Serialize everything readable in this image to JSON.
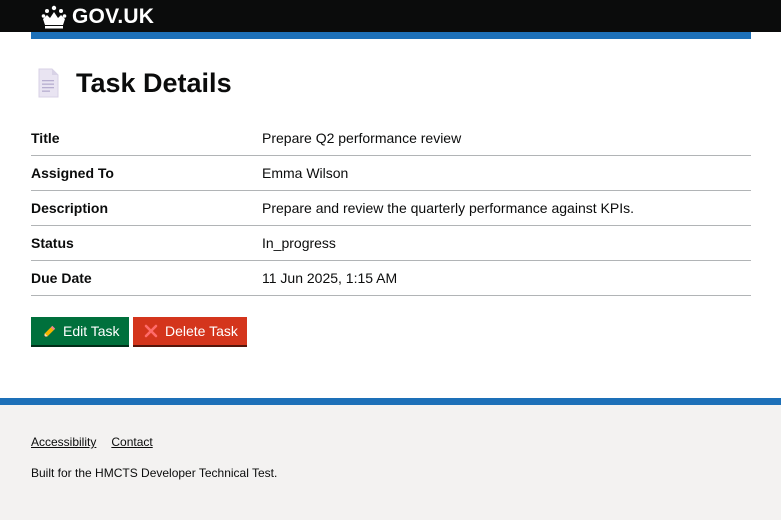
{
  "header": {
    "logo_text": "GOV.UK"
  },
  "page": {
    "title": "Task Details",
    "title_icon": "document-icon"
  },
  "summary": [
    {
      "key": "Title",
      "value": "Prepare Q2 performance review"
    },
    {
      "key": "Assigned To",
      "value": "Emma Wilson"
    },
    {
      "key": "Description",
      "value": "Prepare and review the quarterly performance against KPIs."
    },
    {
      "key": "Status",
      "value": "In_progress"
    },
    {
      "key": "Due Date",
      "value": "11 Jun 2025, 1:15 AM"
    }
  ],
  "actions": {
    "edit_label": "Edit Task",
    "edit_icon": "pencil-icon",
    "delete_label": "Delete Task",
    "delete_icon": "cross-icon"
  },
  "footer": {
    "links": [
      "Accessibility",
      "Contact"
    ],
    "note": "Built for the HMCTS Developer Technical Test."
  },
  "colors": {
    "header_bg": "#0b0c0c",
    "brand_blue": "#1d70b8",
    "edit_green": "#00703c",
    "delete_red": "#d4351c",
    "footer_bg": "#f3f2f1"
  }
}
